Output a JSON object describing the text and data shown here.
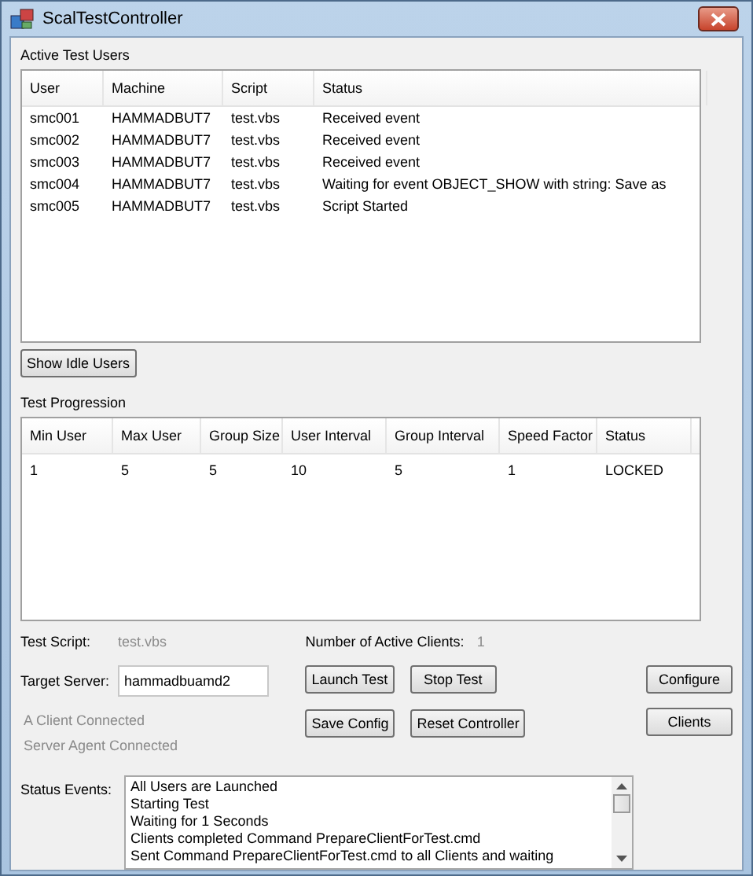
{
  "window": {
    "title": "ScalTestController"
  },
  "active_users": {
    "label": "Active Test Users",
    "columns": [
      "User",
      "Machine",
      "Script",
      "Status"
    ],
    "rows": [
      [
        "smc001",
        "HAMMADBUT7",
        "test.vbs",
        "Received event"
      ],
      [
        "smc002",
        "HAMMADBUT7",
        "test.vbs",
        "Received event"
      ],
      [
        "smc003",
        "HAMMADBUT7",
        "test.vbs",
        "Received event"
      ],
      [
        "smc004",
        "HAMMADBUT7",
        "test.vbs",
        "Waiting for event OBJECT_SHOW with string: Save as"
      ],
      [
        "smc005",
        "HAMMADBUT7",
        "test.vbs",
        "Script Started"
      ]
    ]
  },
  "show_idle_button": "Show Idle Users",
  "progression": {
    "label": "Test Progression",
    "columns": [
      "Min User",
      "Max User",
      "Group Size",
      "User Interval",
      "Group Interval",
      "Speed Factor",
      "Status"
    ],
    "rows": [
      [
        "1",
        "5",
        "5",
        "10",
        "5",
        "1",
        "LOCKED"
      ]
    ]
  },
  "test_script": {
    "label": "Test Script:",
    "value": "test.vbs"
  },
  "active_clients": {
    "label": "Number of Active Clients:",
    "value": "1"
  },
  "target_server": {
    "label": "Target Server:",
    "value": "hammadbuamd2"
  },
  "buttons": {
    "launch": "Launch Test",
    "stop": "Stop Test",
    "configure": "Configure",
    "save": "Save Config",
    "reset": "Reset Controller",
    "clients": "Clients"
  },
  "connection_status": [
    "A Client Connected",
    "Server Agent Connected"
  ],
  "status_events": {
    "label": "Status Events:",
    "items": [
      "All Users are Launched",
      "Starting Test",
      "Waiting for 1 Seconds",
      "Clients completed Command PrepareClientForTest.cmd",
      "Sent Command PrepareClientForTest.cmd to all Clients and waiting"
    ]
  }
}
